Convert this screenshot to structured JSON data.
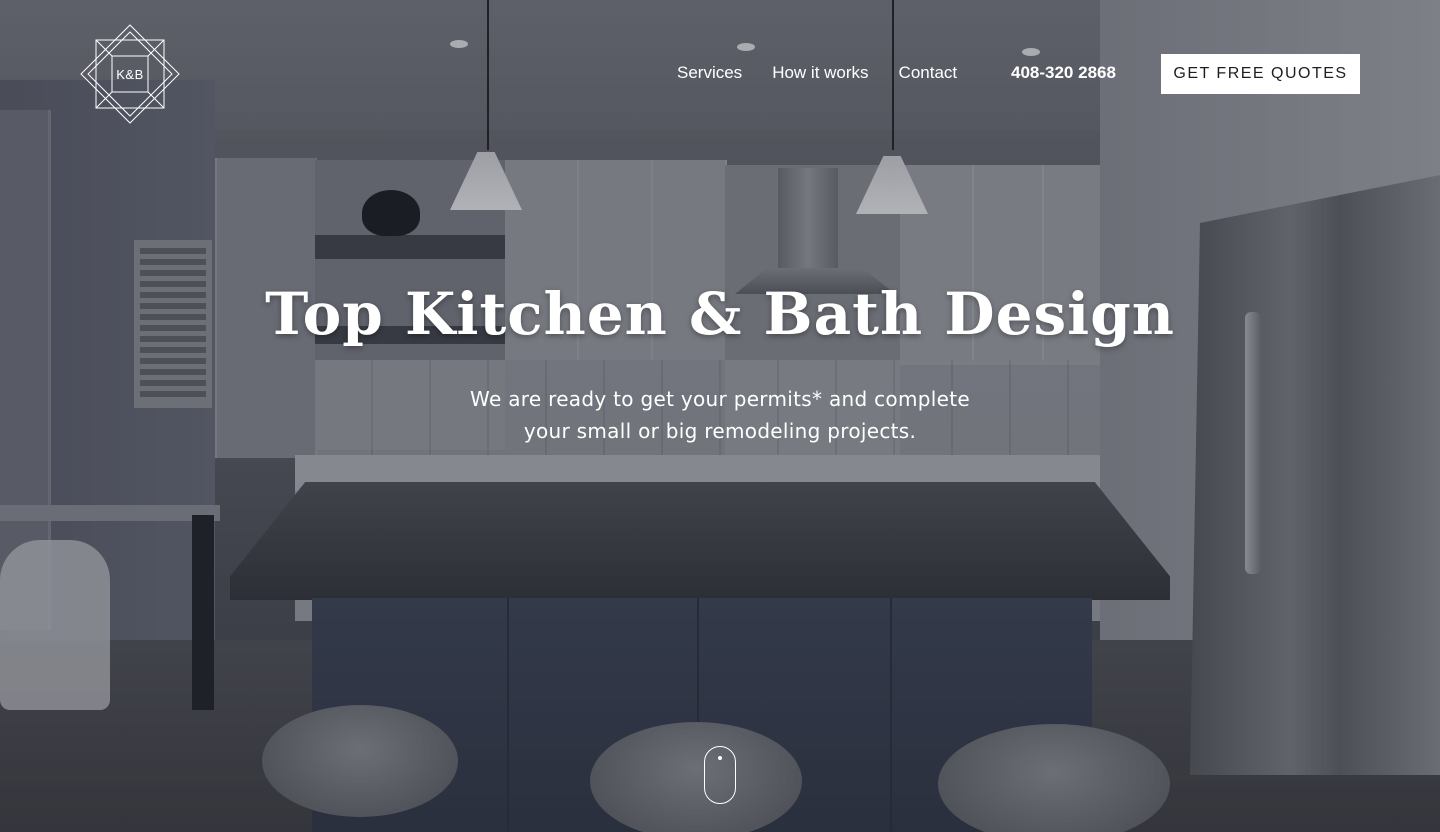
{
  "brand": {
    "logo_text": "K&B"
  },
  "nav": {
    "items": [
      {
        "label": "Services"
      },
      {
        "label": "How it works"
      },
      {
        "label": "Contact"
      }
    ],
    "phone": "408-320 2868",
    "cta_label": "GET FREE QUOTES"
  },
  "hero": {
    "title": "Top Kitchen & Bath Design",
    "subtitle_line1": "We are ready to get your permits* and complete",
    "subtitle_line2": "your small or big remodeling projects.",
    "background": "kitchen-interior-photo"
  },
  "colors": {
    "overlay": "#282a34",
    "cta_bg": "#ffffff",
    "cta_text": "#1d1e22",
    "text": "#ffffff"
  },
  "icons": {
    "logo": "diamond-frame-icon",
    "scroll": "scroll-mouse-icon"
  }
}
